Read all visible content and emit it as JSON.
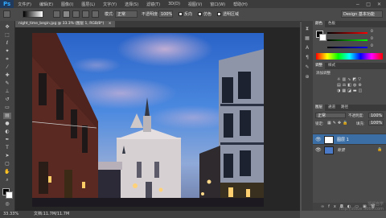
{
  "app": {
    "logo": "Ps"
  },
  "menu": [
    "文件(F)",
    "编辑(E)",
    "图像(I)",
    "图层(L)",
    "文字(Y)",
    "选择(S)",
    "滤镜(T)",
    "3D(D)",
    "视图(V)",
    "窗口(W)",
    "帮助(H)"
  ],
  "window_controls": [
    "−",
    "□",
    "✕"
  ],
  "options": {
    "mode_label": "模式:",
    "mode_value": "正常",
    "opacity_label": "不透明度:",
    "opacity_value": "100%",
    "reverse_label": "反向",
    "dither_label": "仿色",
    "transparency_label": "透明区域",
    "workspace_value": "Design 基本功能"
  },
  "doc_tab": {
    "title": "night_time_begin.jpg @ 33.3% (图层 1, RGB/8*)",
    "close": "×"
  },
  "status": {
    "zoom": "33.33%",
    "doc": "文档:11.7M/11.7M"
  },
  "panels": {
    "color_tabs": [
      "颜色",
      "色板"
    ],
    "adjust_tabs": [
      "调整",
      "样式"
    ],
    "adjust_title": "添加调整",
    "layers_tabs": [
      "图层",
      "通道",
      "路径"
    ],
    "blend_mode": "正常",
    "opacity_label": "不透明度:",
    "opacity_value": "100%",
    "lock_label": "锁定:",
    "fill_label": "填充:",
    "fill_value": "100%",
    "layers": [
      {
        "name": "图层 1",
        "selected": true
      },
      {
        "name": "背景",
        "selected": false
      }
    ],
    "color_values": [
      "0",
      "0",
      "0"
    ]
  },
  "watermark": {
    "line1": "溜溜自学",
    "line2": "http://zixue.3d66.com"
  },
  "colors": {
    "accent": "#31a8ff",
    "selected_layer": "#3a6ea5"
  }
}
